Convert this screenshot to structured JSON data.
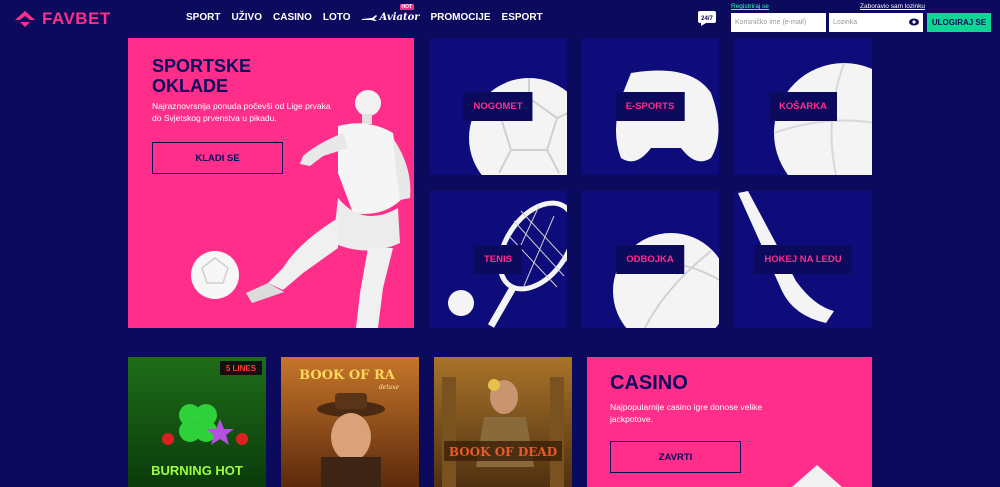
{
  "brand": {
    "name": "FAVBET",
    "color": "#ff2e8a"
  },
  "nav": {
    "items": [
      "SPORT",
      "UŽIVO",
      "CASINO",
      "LOTO"
    ],
    "aviator": "Aviator",
    "aviator_badge": "HOT",
    "items_after": [
      "PROMOCIJE",
      "ESPORT"
    ]
  },
  "chat": {
    "label": "24/7"
  },
  "login": {
    "register_link": "Registriraj se",
    "forgot_link": "Zaboravio sam lozinku",
    "username_placeholder": "Korisničko ime (e-mail)",
    "password_placeholder": "Lozinka",
    "submit_label": "ULOGIRAJ SE"
  },
  "sports_hero": {
    "title": "SPORTSKE OKLADE",
    "description": "Najraznovrsnija ponuda počevši od Lige prvaka do Svjetskog prvenstva u pikadu.",
    "cta": "KLADI SE"
  },
  "sport_tiles": [
    {
      "label": "NOGOMET",
      "icon": "football-icon"
    },
    {
      "label": "E-SPORTS",
      "icon": "gamepad-icon"
    },
    {
      "label": "KOŠARKA",
      "icon": "basketball-icon"
    },
    {
      "label": "TENIS",
      "icon": "tennis-racket-icon"
    },
    {
      "label": "ODBOJKA",
      "icon": "volleyball-icon"
    },
    {
      "label": "HOKEJ NA LEDU",
      "icon": "hockey-stick-icon"
    }
  ],
  "games": [
    {
      "title": "BURNING HOT",
      "badge": "5 LINES"
    },
    {
      "title": "BOOK OF RA",
      "subtitle": "deluxe"
    },
    {
      "title": "BOOK OF DEAD"
    }
  ],
  "casino_hero": {
    "title": "CASINO",
    "description": "Najpopularnije casino igre donose velike jackpotove.",
    "cta": "ZAVRTI"
  },
  "colors": {
    "navy": "#0b0a5c",
    "tile": "#0e0c7a",
    "pink": "#ff2e8a",
    "green": "#0fd694"
  }
}
